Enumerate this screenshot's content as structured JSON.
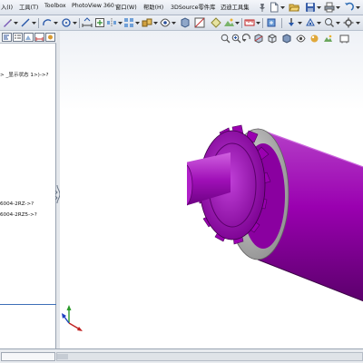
{
  "menubar": {
    "items": [
      "入(I)",
      "工具(T)",
      "Toolbox",
      "PhotoView 360",
      "窗口(W)",
      "帮助(H)",
      "3DSource零件库",
      "迈迪工具集"
    ]
  },
  "feature_tree": {
    "lines": [
      "> _显示状态 1>)->?",
      "6004-2RZ->?",
      "6004-2RZ5->?"
    ]
  },
  "icons": {
    "menubar": [
      "pin-icon",
      "new-document-icon",
      "open-folder-icon",
      "save-icon",
      "print-icon",
      "undo-icon",
      "rebuild-icon",
      "options-icon"
    ],
    "toolbar": [
      "sketch-icon",
      "line-icon",
      "circle-icon",
      "arc-icon",
      "dimension-icon",
      "relation-icon",
      "mirror-icon",
      "pattern-icon",
      "assembly-icon",
      "view-icon",
      "display-icon",
      "section-icon",
      "appearance-icon",
      "scene-icon",
      "measure-icon",
      "move-component-icon",
      "rotate-icon",
      "reference-icon"
    ],
    "tree_tabs": [
      "feature-manager-icon",
      "property-manager-icon",
      "configuration-manager-icon",
      "dimxpert-icon",
      "display-manager-icon"
    ],
    "heads_up": [
      "zoom-to-fit-icon",
      "zoom-area-icon",
      "previous-view-icon",
      "section-view-icon",
      "view-orientation-icon",
      "display-style-icon",
      "hide-show-icon",
      "edit-appearance-icon",
      "apply-scene-icon",
      "view-settings-icon"
    ]
  },
  "colors": {
    "part_body": "#9a00b0",
    "part_shadow": "#5a006a",
    "part_highlight": "#d060e0",
    "collar": "#b5b5b5",
    "accent_blue": "#3d6fb8"
  }
}
